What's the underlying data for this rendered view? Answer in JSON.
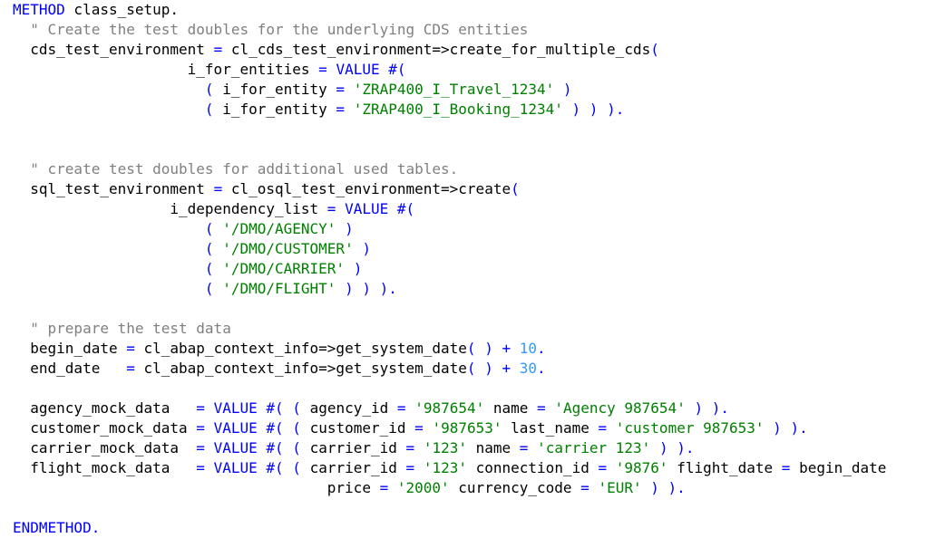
{
  "colors": {
    "keyword": "#0000ff",
    "comment": "#808080",
    "string": "#008000",
    "number": "#3399ff",
    "operator": "#0000ff",
    "plain": "#000000",
    "background": "#ffffff"
  },
  "code_lines": [
    [
      [
        "kw",
        "METHOD"
      ],
      [
        "pl",
        " class_setup"
      ],
      [
        "pl",
        "."
      ]
    ],
    [
      [
        "pl",
        "  "
      ],
      [
        "cm",
        "\" Create the test doubles for the underlying CDS entities"
      ]
    ],
    [
      [
        "pl",
        "  cds_test_environment "
      ],
      [
        "op",
        "="
      ],
      [
        "pl",
        " cl_cds_test_environment=>create_for_multiple_cds"
      ],
      [
        "op",
        "("
      ]
    ],
    [
      [
        "pl",
        "                    i_for_entities "
      ],
      [
        "op",
        "="
      ],
      [
        "pl",
        " "
      ],
      [
        "kw",
        "VALUE"
      ],
      [
        "pl",
        " "
      ],
      [
        "kw",
        "#("
      ]
    ],
    [
      [
        "pl",
        "                      "
      ],
      [
        "op",
        "("
      ],
      [
        "pl",
        " i_for_entity "
      ],
      [
        "op",
        "="
      ],
      [
        "pl",
        " "
      ],
      [
        "st",
        "'ZRAP400_I_Travel_1234'"
      ],
      [
        "pl",
        " "
      ],
      [
        "op",
        ")"
      ]
    ],
    [
      [
        "pl",
        "                      "
      ],
      [
        "op",
        "("
      ],
      [
        "pl",
        " i_for_entity "
      ],
      [
        "op",
        "="
      ],
      [
        "pl",
        " "
      ],
      [
        "st",
        "'ZRAP400_I_Booking_1234'"
      ],
      [
        "pl",
        " "
      ],
      [
        "op",
        ") ) )."
      ]
    ],
    [],
    [],
    [
      [
        "pl",
        "  "
      ],
      [
        "cm",
        "\" create test doubles for additional used tables."
      ]
    ],
    [
      [
        "pl",
        "  sql_test_environment "
      ],
      [
        "op",
        "="
      ],
      [
        "pl",
        " cl_osql_test_environment=>create"
      ],
      [
        "op",
        "("
      ]
    ],
    [
      [
        "pl",
        "                  i_dependency_list "
      ],
      [
        "op",
        "="
      ],
      [
        "pl",
        " "
      ],
      [
        "kw",
        "VALUE"
      ],
      [
        "pl",
        " "
      ],
      [
        "kw",
        "#("
      ]
    ],
    [
      [
        "pl",
        "                      "
      ],
      [
        "op",
        "("
      ],
      [
        "pl",
        " "
      ],
      [
        "st",
        "'/DMO/AGENCY'"
      ],
      [
        "pl",
        " "
      ],
      [
        "op",
        ")"
      ]
    ],
    [
      [
        "pl",
        "                      "
      ],
      [
        "op",
        "("
      ],
      [
        "pl",
        " "
      ],
      [
        "st",
        "'/DMO/CUSTOMER'"
      ],
      [
        "pl",
        " "
      ],
      [
        "op",
        ")"
      ]
    ],
    [
      [
        "pl",
        "                      "
      ],
      [
        "op",
        "("
      ],
      [
        "pl",
        " "
      ],
      [
        "st",
        "'/DMO/CARRIER'"
      ],
      [
        "pl",
        " "
      ],
      [
        "op",
        ")"
      ]
    ],
    [
      [
        "pl",
        "                      "
      ],
      [
        "op",
        "("
      ],
      [
        "pl",
        " "
      ],
      [
        "st",
        "'/DMO/FLIGHT'"
      ],
      [
        "pl",
        " "
      ],
      [
        "op",
        ") ) )."
      ]
    ],
    [],
    [
      [
        "pl",
        "  "
      ],
      [
        "cm",
        "\" prepare the test data"
      ]
    ],
    [
      [
        "pl",
        "  begin_date "
      ],
      [
        "op",
        "="
      ],
      [
        "pl",
        " cl_abap_context_info=>get_system_date"
      ],
      [
        "op",
        "("
      ],
      [
        "pl",
        " "
      ],
      [
        "op",
        ")"
      ],
      [
        "pl",
        " "
      ],
      [
        "op",
        "+"
      ],
      [
        "pl",
        " "
      ],
      [
        "nm",
        "10"
      ],
      [
        "op",
        "."
      ]
    ],
    [
      [
        "pl",
        "  end_date   "
      ],
      [
        "op",
        "="
      ],
      [
        "pl",
        " cl_abap_context_info=>get_system_date"
      ],
      [
        "op",
        "("
      ],
      [
        "pl",
        " "
      ],
      [
        "op",
        ")"
      ],
      [
        "pl",
        " "
      ],
      [
        "op",
        "+"
      ],
      [
        "pl",
        " "
      ],
      [
        "nm",
        "30"
      ],
      [
        "op",
        "."
      ]
    ],
    [],
    [
      [
        "pl",
        "  agency_mock_data   "
      ],
      [
        "op",
        "="
      ],
      [
        "pl",
        " "
      ],
      [
        "kw",
        "VALUE"
      ],
      [
        "pl",
        " "
      ],
      [
        "kw",
        "#("
      ],
      [
        "pl",
        " "
      ],
      [
        "op",
        "("
      ],
      [
        "pl",
        " agency_id "
      ],
      [
        "op",
        "="
      ],
      [
        "pl",
        " "
      ],
      [
        "st",
        "'987654'"
      ],
      [
        "pl",
        " name "
      ],
      [
        "op",
        "="
      ],
      [
        "pl",
        " "
      ],
      [
        "st",
        "'Agency 987654'"
      ],
      [
        "pl",
        " "
      ],
      [
        "op",
        ") )."
      ]
    ],
    [
      [
        "pl",
        "  customer_mock_data "
      ],
      [
        "op",
        "="
      ],
      [
        "pl",
        " "
      ],
      [
        "kw",
        "VALUE"
      ],
      [
        "pl",
        " "
      ],
      [
        "kw",
        "#("
      ],
      [
        "pl",
        " "
      ],
      [
        "op",
        "("
      ],
      [
        "pl",
        " customer_id "
      ],
      [
        "op",
        "="
      ],
      [
        "pl",
        " "
      ],
      [
        "st",
        "'987653'"
      ],
      [
        "pl",
        " last_name "
      ],
      [
        "op",
        "="
      ],
      [
        "pl",
        " "
      ],
      [
        "st",
        "'customer 987653'"
      ],
      [
        "pl",
        " "
      ],
      [
        "op",
        ") )."
      ]
    ],
    [
      [
        "pl",
        "  carrier_mock_data  "
      ],
      [
        "op",
        "="
      ],
      [
        "pl",
        " "
      ],
      [
        "kw",
        "VALUE"
      ],
      [
        "pl",
        " "
      ],
      [
        "kw",
        "#("
      ],
      [
        "pl",
        " "
      ],
      [
        "op",
        "("
      ],
      [
        "pl",
        " carrier_id "
      ],
      [
        "op",
        "="
      ],
      [
        "pl",
        " "
      ],
      [
        "st",
        "'123'"
      ],
      [
        "pl",
        " name "
      ],
      [
        "op",
        "="
      ],
      [
        "pl",
        " "
      ],
      [
        "st",
        "'carrier 123'"
      ],
      [
        "pl",
        " "
      ],
      [
        "op",
        ") )."
      ]
    ],
    [
      [
        "pl",
        "  flight_mock_data   "
      ],
      [
        "op",
        "="
      ],
      [
        "pl",
        " "
      ],
      [
        "kw",
        "VALUE"
      ],
      [
        "pl",
        " "
      ],
      [
        "kw",
        "#("
      ],
      [
        "pl",
        " "
      ],
      [
        "op",
        "("
      ],
      [
        "pl",
        " carrier_id "
      ],
      [
        "op",
        "="
      ],
      [
        "pl",
        " "
      ],
      [
        "st",
        "'123'"
      ],
      [
        "pl",
        " connection_id "
      ],
      [
        "op",
        "="
      ],
      [
        "pl",
        " "
      ],
      [
        "st",
        "'9876'"
      ],
      [
        "pl",
        " flight_date "
      ],
      [
        "op",
        "="
      ],
      [
        "pl",
        " begin_date"
      ]
    ],
    [
      [
        "pl",
        "                                    price "
      ],
      [
        "op",
        "="
      ],
      [
        "pl",
        " "
      ],
      [
        "st",
        "'2000'"
      ],
      [
        "pl",
        " currency_code "
      ],
      [
        "op",
        "="
      ],
      [
        "pl",
        " "
      ],
      [
        "st",
        "'EUR'"
      ],
      [
        "pl",
        " "
      ],
      [
        "op",
        ") )."
      ]
    ],
    [],
    [
      [
        "kw",
        "ENDMETHOD"
      ],
      [
        "op",
        "."
      ]
    ]
  ]
}
